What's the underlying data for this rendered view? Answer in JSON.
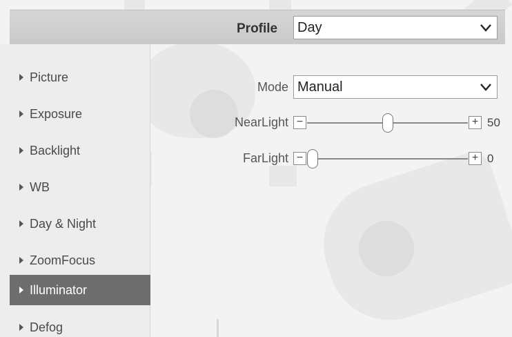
{
  "profile": {
    "label": "Profile",
    "value": "Day"
  },
  "sidebar": {
    "items": [
      {
        "label": "Picture",
        "active": false
      },
      {
        "label": "Exposure",
        "active": false
      },
      {
        "label": "Backlight",
        "active": false
      },
      {
        "label": "WB",
        "active": false
      },
      {
        "label": "Day & Night",
        "active": false
      },
      {
        "label": "ZoomFocus",
        "active": false
      },
      {
        "label": "Illuminator",
        "active": true
      },
      {
        "label": "Defog",
        "active": false
      }
    ]
  },
  "form": {
    "mode": {
      "label": "Mode",
      "value": "Manual"
    },
    "near_light": {
      "label": "NearLight",
      "value": "50",
      "fraction": 0.5
    },
    "far_light": {
      "label": "FarLight",
      "value": "0",
      "fraction": 0.0
    }
  },
  "colors": {
    "active_bg": "#6d6d6d",
    "panel_bg": "#f3f3f3"
  },
  "icons": {
    "caret": "caret-right-icon",
    "select": "chevron-down-icon",
    "minus": "minus-icon",
    "plus": "plus-icon"
  }
}
